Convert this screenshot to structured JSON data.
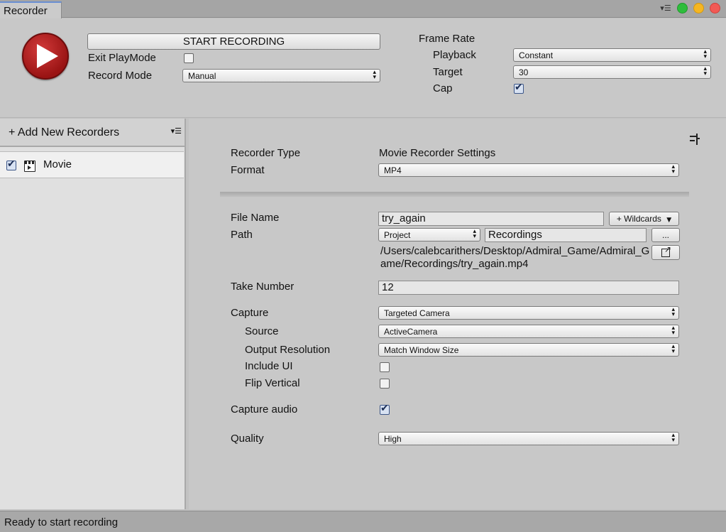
{
  "window": {
    "tab_title": "Recorder",
    "menu_icon": "window-menu-icon",
    "controls": [
      {
        "name": "maximize",
        "color": "#2ebd3c"
      },
      {
        "name": "minimize",
        "color": "#f5b622"
      },
      {
        "name": "close",
        "color": "#f25a55"
      }
    ]
  },
  "top": {
    "start_label": "START RECORDING",
    "exit_playmode_label": "Exit PlayMode",
    "exit_playmode_checked": false,
    "record_mode_label": "Record Mode",
    "record_mode_value": "Manual",
    "frame_rate_label": "Frame Rate",
    "playback_label": "Playback",
    "playback_value": "Constant",
    "target_label": "Target",
    "target_value": "30",
    "cap_label": "Cap",
    "cap_checked": true
  },
  "left": {
    "add_label": "+ Add New Recorders",
    "recorders": [
      {
        "label": "Movie",
        "enabled": true,
        "icon": "clapperboard-icon"
      }
    ]
  },
  "settings": {
    "recorder_type_label": "Recorder Type",
    "recorder_type_value": "Movie Recorder Settings",
    "format_label": "Format",
    "format_value": "MP4",
    "file_name_label": "File Name",
    "file_name_value": "try_again",
    "wildcards_label": "+ Wildcards",
    "path_label": "Path",
    "path_root_value": "Project",
    "path_folder_value": "Recordings",
    "browse_label": "...",
    "full_path": "/Users/calebcarithers/Desktop/Admiral_Game/Admiral_Game/Recordings/try_again.mp4",
    "take_number_label": "Take Number",
    "take_number_value": "12",
    "capture_label": "Capture",
    "capture_value": "Targeted Camera",
    "source_label": "Source",
    "source_value": "ActiveCamera",
    "output_resolution_label": "Output Resolution",
    "output_resolution_value": "Match Window Size",
    "include_ui_label": "Include UI",
    "include_ui_checked": false,
    "flip_vertical_label": "Flip Vertical",
    "flip_vertical_checked": false,
    "capture_audio_label": "Capture audio",
    "capture_audio_checked": true,
    "quality_label": "Quality",
    "quality_value": "High"
  },
  "status": {
    "text": "Ready to start recording"
  }
}
